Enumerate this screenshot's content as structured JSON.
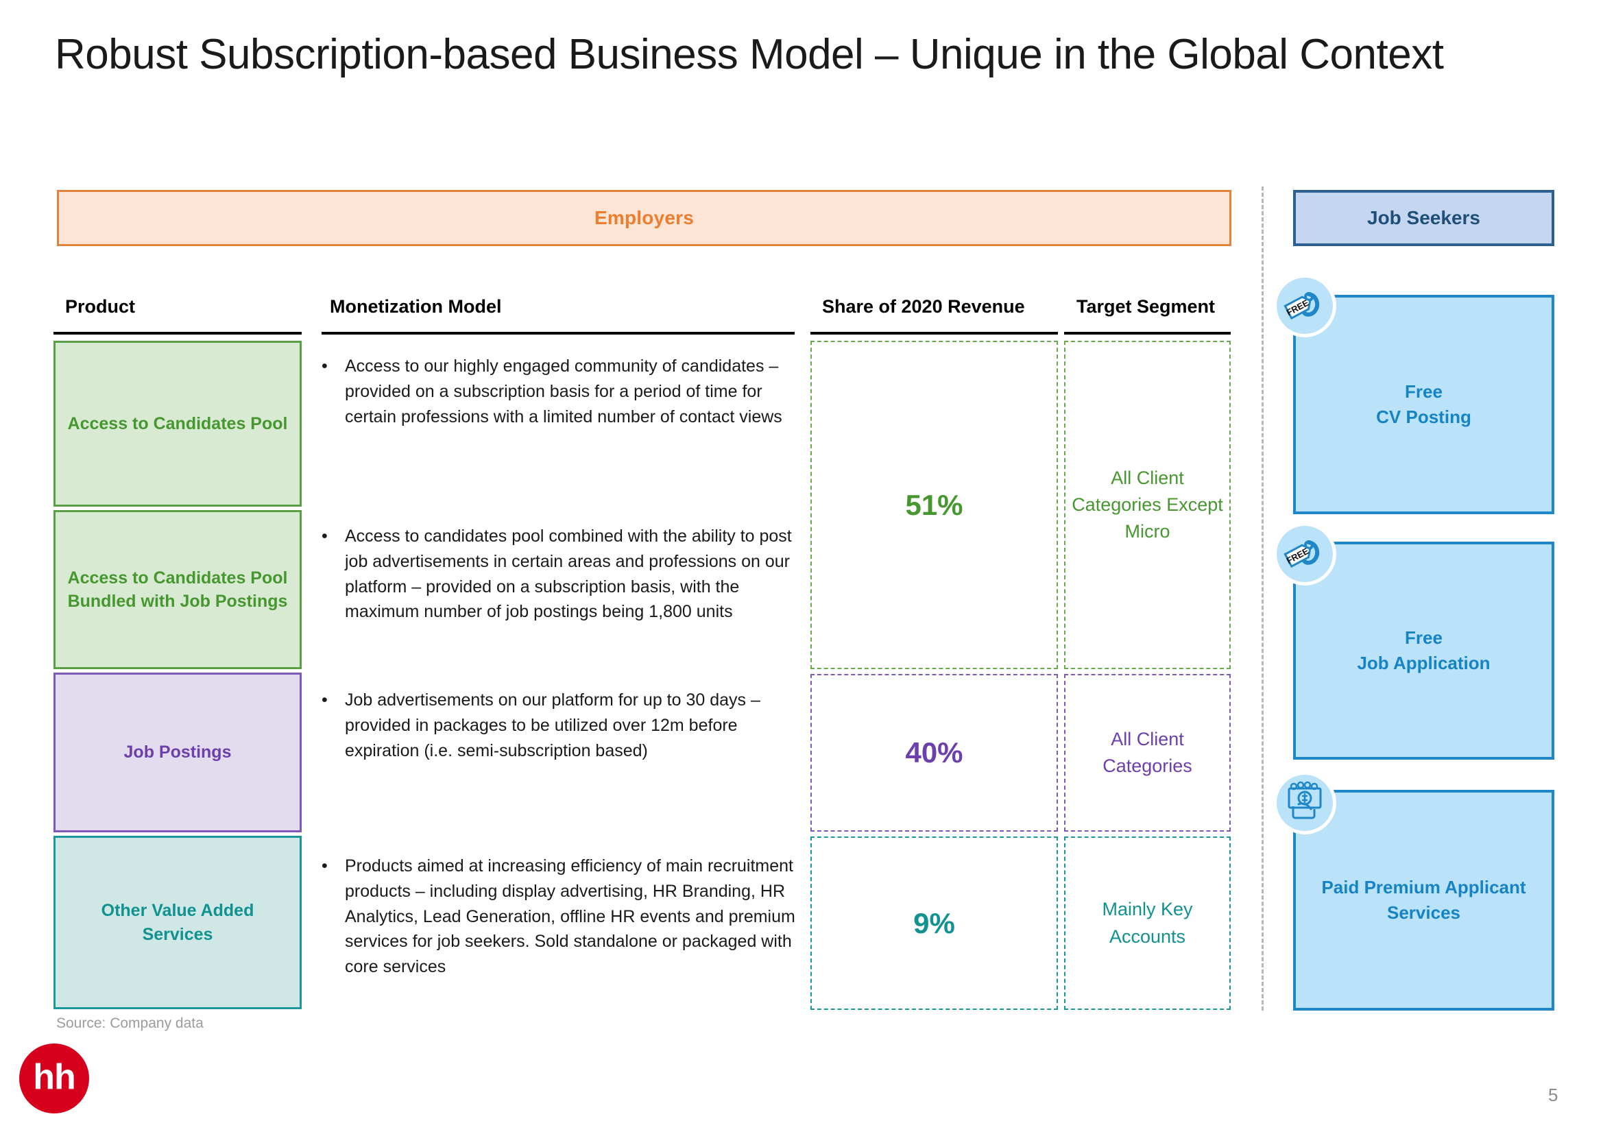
{
  "slide": {
    "title": "Robust Subscription-based Business Model – Unique in the Global Context",
    "page_number": "5",
    "source_note": "Source: Company data",
    "logo_text": "hh"
  },
  "banners": {
    "employers": "Employers",
    "job_seekers": "Job Seekers"
  },
  "table": {
    "headers": {
      "product": "Product",
      "monetization": "Monetization Model",
      "share": "Share of 2020 Revenue",
      "target": "Target Segment"
    },
    "products": [
      {
        "name": "Access to Candidates Pool"
      },
      {
        "name": "Access to Candidates Pool Bundled with Job Postings"
      },
      {
        "name": "Job Postings"
      },
      {
        "name": "Other Value Added Services"
      }
    ],
    "bullets": [
      {
        "marker": "•",
        "text": "Access to our highly engaged community of candidates – provided on a subscription basis for a period of time for certain professions with a limited number of contact views"
      },
      {
        "marker": "•",
        "text": "Access to candidates pool combined with the ability to post job advertisements in certain areas and professions on our platform – provided on a subscription basis, with the maximum number of job postings being 1,800 units"
      },
      {
        "marker": "•",
        "text": "Job advertisements on our platform for up to 30 days – provided in packages to be utilized over 12m before expiration (i.e. semi-subscription based)"
      },
      {
        "marker": "•",
        "text": "Products aimed at increasing efficiency of main recruitment products – including display advertising, HR Branding, HR Analytics, Lead Generation, offline HR events and premium services for job seekers. Sold standalone or packaged with core services"
      }
    ],
    "revenue_rows": [
      {
        "share": "51%",
        "segment": "All Client Categories Except Micro"
      },
      {
        "share": "40%",
        "segment": "All Client Categories"
      },
      {
        "share": "9%",
        "segment": "Mainly Key Accounts"
      }
    ]
  },
  "job_seeker_cards": [
    {
      "label": "Free\nCV Posting",
      "line1": "Free",
      "line2": "CV Posting",
      "icon": "price-tag-free-icon"
    },
    {
      "label": "Free\nJob Application",
      "line1": "Free",
      "line2": "Job Application",
      "icon": "price-tag-free-icon"
    },
    {
      "label": "Paid Premium Applicant Services",
      "line1": "Paid Premium Applicant",
      "line2": "Services",
      "icon": "money-in-hand-icon"
    }
  ],
  "badge_label": "FREE",
  "colors": {
    "employers_accent": "#ed7d31",
    "employers_fill": "#fce5d4",
    "job_seekers_accent": "#1f4e79",
    "job_seekers_fill": "#c5d6f0",
    "green": "#46972f",
    "green_fill": "#d9ead3",
    "purple": "#6c3fad",
    "purple_fill": "#e3dcef",
    "teal": "#11918f",
    "teal_fill": "#cfe8e6",
    "card_blue": "#1683c4",
    "card_fill": "#bae3f9",
    "logo_red": "#d6001c"
  }
}
